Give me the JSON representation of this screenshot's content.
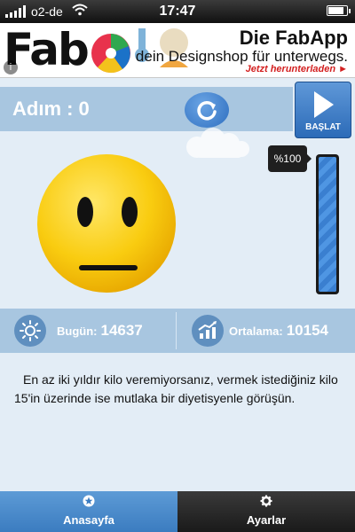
{
  "status_bar": {
    "carrier": "o2-de",
    "time": "17:47"
  },
  "ad": {
    "logo": "Fab",
    "title": "Die FabApp",
    "subtitle": "dein Designshop für unterwegs.",
    "cta": "Jetzt herunterladen ►",
    "info_glyph": "i"
  },
  "header": {
    "step_label": "Adım : 0",
    "start_label": "BAŞLAT"
  },
  "progress": {
    "label": "%100",
    "fraction": 1.0
  },
  "stats": {
    "today_label": "Bugün:",
    "today_value": "14637",
    "avg_label": "Ortalama:",
    "avg_value": "10154"
  },
  "info_text": "En az iki yıldır kilo veremiyorsanız, vermek istediğiniz kilo 15'in üzerinde ise mutlaka bir diyetisyenle görüşün.",
  "tabs": [
    {
      "label": "Anasayfa",
      "icon": "star-icon"
    },
    {
      "label": "Ayarlar",
      "icon": "gear-icon"
    }
  ],
  "colors": {
    "background": "#e3edf6",
    "band": "#a8c6e0",
    "accent": "#3b7cc0",
    "smiley": "#f7c600"
  }
}
